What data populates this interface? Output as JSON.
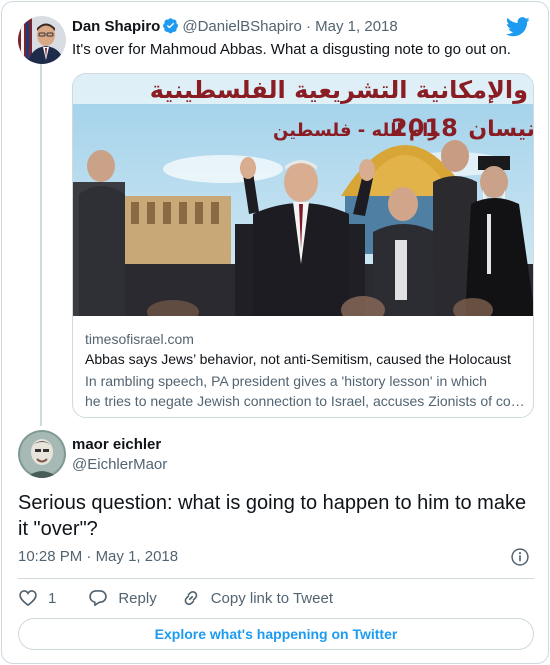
{
  "quoted_tweet": {
    "author_name": "Dan Shapiro",
    "handle": "@DanielBShapiro",
    "separator": "·",
    "date": "May 1, 2018",
    "text": "It's over for Mahmoud Abbas. What a disgusting note to go out on.",
    "link_card": {
      "domain": "timesofisrael.com",
      "title": "Abbas says Jews’ behavior, not anti-Semitism, caused the Holocaust",
      "description_line1": "In rambling speech, PA president gives a 'history lesson' in which",
      "description_line2": "he tries to negate Jewish connection to Israel, accuses Zionists of collaborating with the Nazis",
      "image_banner_year": "2018",
      "image_banner_city": "رام الله - فلسطين",
      "image_banner_top": "والإمكانية التشريعية الفلسطينية",
      "image_banner_right": "نيسان"
    }
  },
  "reply_tweet": {
    "author_name": "maor eichler",
    "handle": "@EichlerMaor",
    "text": "Serious question: what is going to happen to him to make it \"over\"?",
    "time": "10:28 PM",
    "separator": "·",
    "date": "May 1, 2018"
  },
  "actions": {
    "like_count": "1",
    "reply_label": "Reply",
    "copy_link_label": "Copy link to Tweet"
  },
  "explore_label": "Explore what's happening on Twitter",
  "colors": {
    "brand_blue": "#1d9bf0",
    "text_primary": "#0f1419",
    "text_secondary": "#536471",
    "border": "#cfd9de"
  },
  "icons": [
    "twitter-logo-icon",
    "verified-badge-icon",
    "info-icon",
    "heart-icon",
    "reply-bubble-icon",
    "link-icon"
  ]
}
